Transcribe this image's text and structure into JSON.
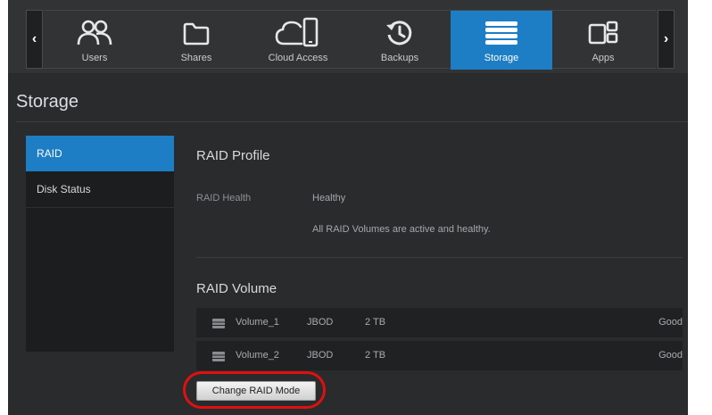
{
  "nav": {
    "prev_arrow": "‹",
    "next_arrow": "›",
    "items": [
      {
        "label": "Users",
        "icon": "users-icon"
      },
      {
        "label": "Shares",
        "icon": "folder-icon"
      },
      {
        "label": "Cloud Access",
        "icon": "cloud-device-icon"
      },
      {
        "label": "Backups",
        "icon": "backup-history-icon"
      },
      {
        "label": "Storage",
        "icon": "storage-icon",
        "active": true
      },
      {
        "label": "Apps",
        "icon": "apps-icon"
      }
    ]
  },
  "page": {
    "title": "Storage"
  },
  "sidebar": {
    "items": [
      {
        "label": "RAID",
        "active": true
      },
      {
        "label": "Disk Status"
      }
    ]
  },
  "raid_profile": {
    "title": "RAID Profile",
    "health_label": "RAID Health",
    "health_value": "Healthy",
    "health_detail": "All RAID Volumes are active and healthy."
  },
  "raid_volume": {
    "title": "RAID Volume",
    "volumes": [
      {
        "name": "Volume_1",
        "type": "JBOD",
        "size": "2 TB",
        "status": "Good"
      },
      {
        "name": "Volume_2",
        "type": "JBOD",
        "size": "2 TB",
        "status": "Good"
      }
    ],
    "change_button": "Change RAID Mode"
  },
  "colors": {
    "accent": "#1d7ec6",
    "background": "#2a2b2d",
    "highlight_ring": "#e01010"
  }
}
